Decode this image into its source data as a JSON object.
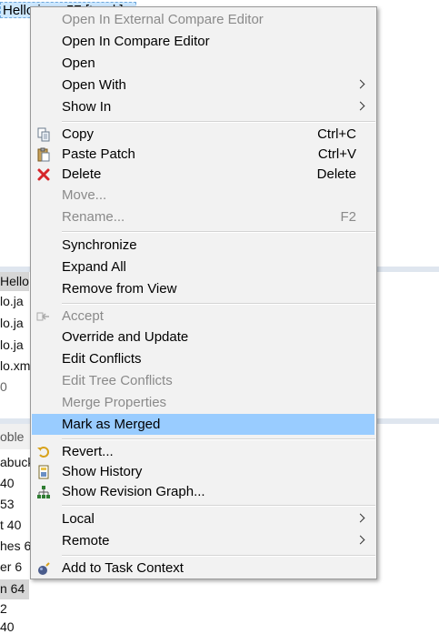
{
  "background": {
    "top_item": "Hello.java 57 [trunk]",
    "editor_lines": [
      "Hello",
      "lo.ja",
      "lo.ja",
      "lo.ja",
      "lo.xm",
      "0"
    ],
    "problems_tab": "oble",
    "problems_lines": [
      "abuck",
      "40",
      "53",
      "t 40",
      "hes 6",
      "er 6",
      "n 64",
      "2",
      "40"
    ]
  },
  "menu": {
    "items": [
      {
        "label": "Open In External Compare Editor",
        "disabled": true
      },
      {
        "label": "Open In Compare Editor"
      },
      {
        "label": "Open"
      },
      {
        "label": "Open With",
        "submenu": true
      },
      {
        "label": "Show In",
        "submenu": true
      },
      {
        "label": "Copy",
        "accel": "Ctrl+C",
        "icon": "copy-icon"
      },
      {
        "label": "Paste Patch",
        "accel": "Ctrl+V",
        "icon": "paste-icon"
      },
      {
        "label": "Delete",
        "accel": "Delete",
        "icon": "delete-icon"
      },
      {
        "label": "Move...",
        "disabled": true
      },
      {
        "label": "Rename...",
        "accel": "F2",
        "disabled": true
      },
      {
        "label": "Synchronize"
      },
      {
        "label": "Expand All"
      },
      {
        "label": "Remove from View"
      },
      {
        "label": "Accept",
        "disabled": true,
        "icon": "accept-icon"
      },
      {
        "label": "Override and Update"
      },
      {
        "label": "Edit Conflicts"
      },
      {
        "label": "Edit Tree Conflicts",
        "disabled": true
      },
      {
        "label": "Merge Properties",
        "disabled": true
      },
      {
        "label": "Mark as Merged",
        "highlighted": true
      },
      {
        "label": "Revert...",
        "icon": "revert-icon"
      },
      {
        "label": "Show History",
        "icon": "history-icon"
      },
      {
        "label": "Show Revision Graph...",
        "icon": "revision-graph-icon"
      },
      {
        "label": "Local",
        "submenu": true
      },
      {
        "label": "Remote",
        "submenu": true
      },
      {
        "label": "Add to Task Context",
        "icon": "task-context-icon"
      }
    ],
    "highlight_color": "#99ccff",
    "disabled_color": "#8a8a8a"
  }
}
